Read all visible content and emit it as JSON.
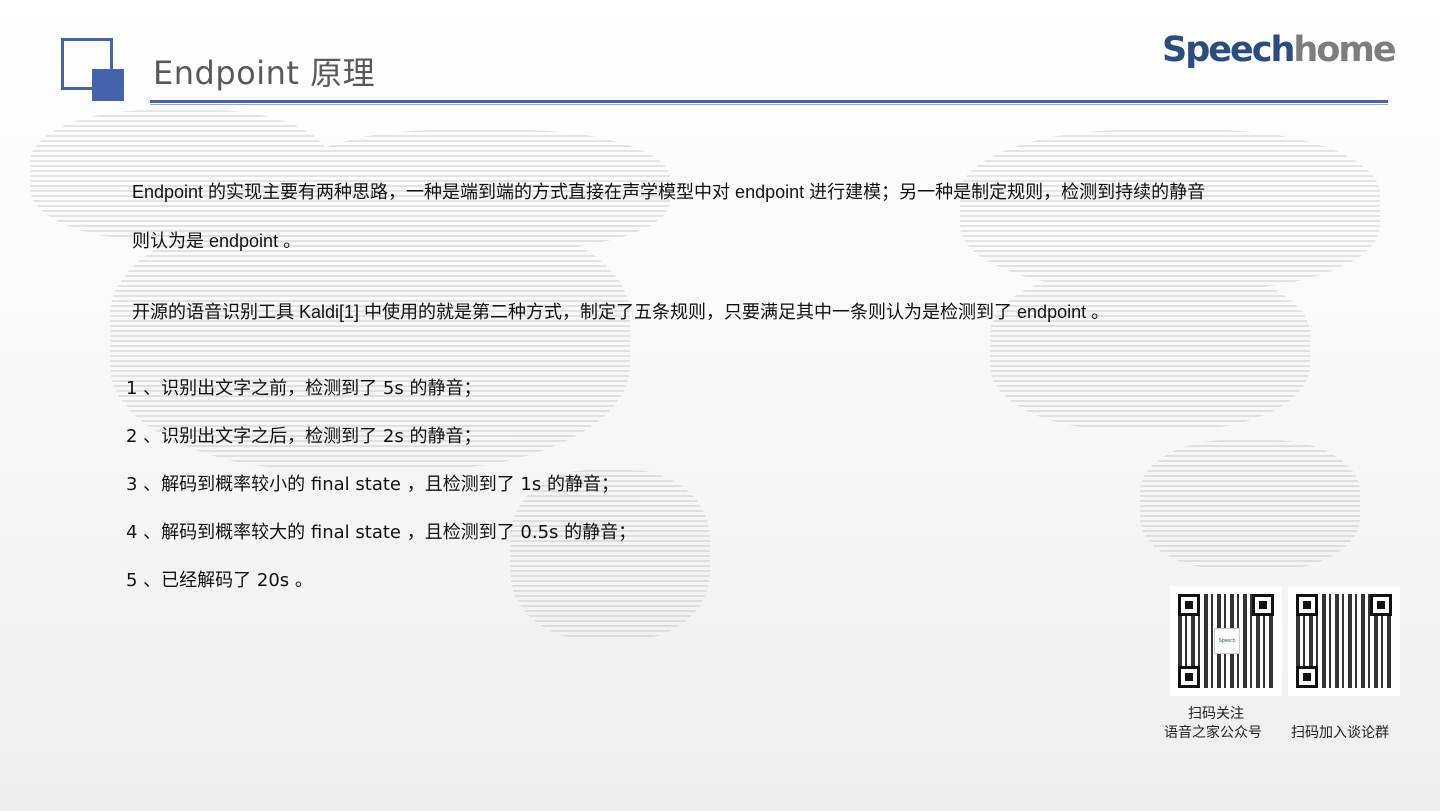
{
  "header": {
    "title": "Endpoint  原理",
    "brand_part1": "Speech",
    "brand_part2": "home"
  },
  "body": {
    "paragraph1_line1": "Endpoint  的实现主要有两种思路，一种是端到端的方式直接在声学模型中对  endpoint  进行建模；另一种是制定规则，检测到持续的静音",
    "paragraph1_line2": "则认为是  endpoint 。",
    "paragraph2": "开源的语音识别工具 Kaldi[1] 中使用的就是第二种方式，制定了五条规则，只要满足其中一条则认为是检测到了  endpoint 。",
    "rules": [
      "1 、识别出文字之前，检测到了  5s  的静音；",
      "2 、识别出文字之后，检测到了  2s  的静音；",
      "3 、解码到概率较小的  final state ，且检测到了  1s  的静音；",
      "4 、解码到概率较大的  final state ，且检测到了  0.5s  的静音；",
      "5 、已经解码了  20s 。"
    ]
  },
  "qr_codes": {
    "caption1_line1": "扫码关注",
    "caption1_line2": "语音之家公众号",
    "caption2": "扫码加入谈论群",
    "icon1": "qr-code-icon",
    "icon2": "qr-code-icon"
  },
  "colors": {
    "accent": "#4563ad",
    "brand_dark": "#2b4c7e",
    "title_gray": "#595959"
  }
}
